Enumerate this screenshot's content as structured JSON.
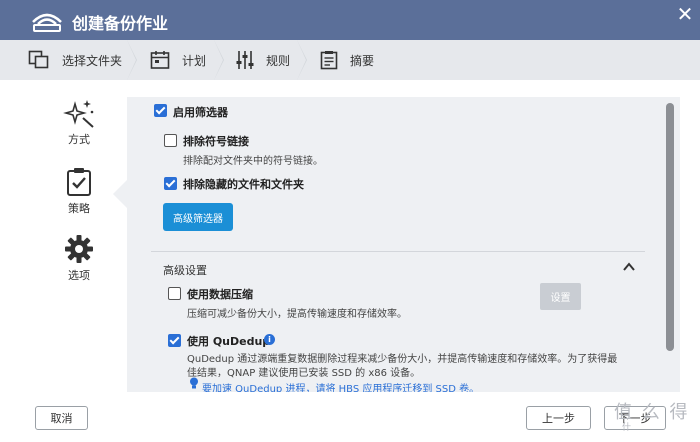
{
  "window": {
    "title": "创建备份作业",
    "close_icon": "close-icon"
  },
  "steps": [
    {
      "label": "选择文件夹",
      "icon": "folder-copy-icon"
    },
    {
      "label": "计划",
      "icon": "calendar-icon"
    },
    {
      "label": "规则",
      "icon": "sliders-icon"
    },
    {
      "label": "摘要",
      "icon": "clipboard-icon"
    }
  ],
  "sidebar": {
    "items": [
      {
        "label": "方式",
        "icon": "sparkles-icon"
      },
      {
        "label": "策略",
        "icon": "clipboard-check-icon"
      },
      {
        "label": "选项",
        "icon": "gear-icon"
      }
    ]
  },
  "filters": {
    "enable_label": "启用筛选器",
    "enable_checked": true,
    "exclude_symlinks_label": "排除符号链接",
    "exclude_symlinks_checked": false,
    "exclude_symlinks_desc": "排除配对文件夹中的符号链接。",
    "exclude_hidden_label": "排除隐藏的文件和文件夹",
    "exclude_hidden_checked": true,
    "advanced_filter_button": "高级筛选器"
  },
  "advanced": {
    "title": "高级设置",
    "compression_label": "使用数据压缩",
    "compression_checked": false,
    "compression_desc": "压缩可减少备份大小，提高传输速度和存储效率。",
    "settings_button": "设置",
    "qudedup_label": "使用 QuDedup",
    "qudedup_checked": true,
    "qudedup_desc_1": "QuDedup 通过源端重复数据删除过程来减少备份大小，并提高传输速度和存储效率。为了获得最",
    "qudedup_desc_2": "佳结果，QNAP 建议使用已安装 SSD 的 x86 设备。",
    "qudedup_link": "要加速 QuDedup 进程，请将 HBS 应用程序迁移到 SSD 卷。"
  },
  "footer": {
    "cancel": "取消",
    "prev": "上一步",
    "next": "下一步"
  },
  "watermark": {
    "main": "值 么 得",
    "sub": "什"
  },
  "colors": {
    "titlebar": "#5b6f99",
    "accent": "#2a6fd6",
    "primary_button": "#1b8fd6"
  }
}
